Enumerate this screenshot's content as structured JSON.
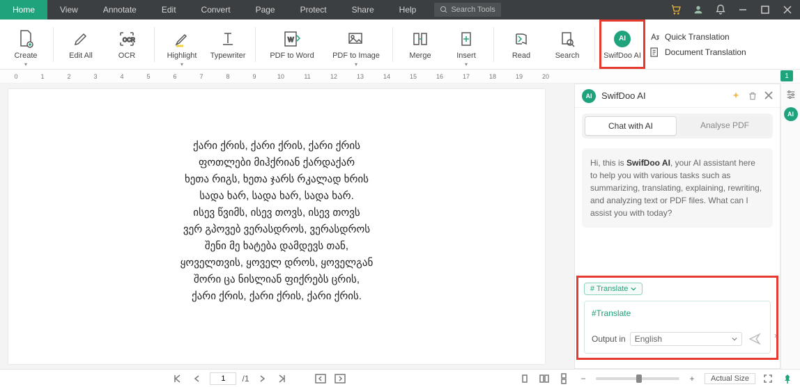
{
  "menu": {
    "items": [
      "Home",
      "View",
      "Annotate",
      "Edit",
      "Convert",
      "Page",
      "Protect",
      "Share",
      "Help"
    ],
    "active": "Home",
    "search_placeholder": "Search Tools"
  },
  "ribbon": {
    "buttons": [
      {
        "id": "create",
        "label": "Create"
      },
      {
        "id": "editall",
        "label": "Edit All"
      },
      {
        "id": "ocr",
        "label": "OCR"
      },
      {
        "id": "highlight",
        "label": "Highlight"
      },
      {
        "id": "typewriter",
        "label": "Typewriter"
      },
      {
        "id": "pdf2word",
        "label": "PDF to Word"
      },
      {
        "id": "pdf2image",
        "label": "PDF to Image"
      },
      {
        "id": "merge",
        "label": "Merge"
      },
      {
        "id": "insert",
        "label": "Insert"
      },
      {
        "id": "read",
        "label": "Read"
      },
      {
        "id": "search",
        "label": "Search"
      },
      {
        "id": "swifdooai",
        "label": "SwifDoo AI"
      }
    ],
    "translate_group": {
      "quick": "Quick Translation",
      "document": "Document Translation"
    }
  },
  "ruler": {
    "numbers": [
      0,
      1,
      2,
      3,
      4,
      5,
      6,
      7,
      8,
      9,
      10,
      11,
      12,
      13,
      14,
      15,
      16,
      17,
      18,
      19,
      20
    ],
    "page_badge": "1"
  },
  "document": {
    "lines": [
      "ქარი ქრის, ქარი ქრის, ქარი ქრის",
      "ფოთლები მიჰქრიან ქარდაქარ",
      "ხეთა რიგს, ხეთა ჯარს რკალად ხრის",
      "სადა ხარ, სადა ხარ, სადა ხარ.",
      "ისევ წვიმს, ისევ თოვს, ისევ თოვს",
      "ვერ გპოვებ ვერასდროს, ვერასდროს",
      "შენი მე ხატება დამდევს თან,",
      "ყოველთვის, ყოველ დროს, ყოველგან",
      "შორი ცა ნისლიან ფიქრებს ცრის,",
      "ქარი ქრის, ქარი ქრის, ქარი ქრის."
    ]
  },
  "ai_panel": {
    "title": "SwifDoo AI",
    "tabs": {
      "chat": "Chat with AI",
      "analyse": "Analyse PDF"
    },
    "welcome_pre": "Hi, this is ",
    "welcome_bold": "SwifDoo AI",
    "welcome_post": ", your AI assistant here to help you with various tasks such as summarizing, translating, explaining, rewriting, and analyzing text or PDF files. What can I assist you with today?",
    "chip": "# Translate",
    "input_tag": "#Translate",
    "output_label": "Output in",
    "output_lang": "English"
  },
  "status": {
    "page_current": "1",
    "page_sep": "/1",
    "zoom_label": "Actual Size"
  }
}
